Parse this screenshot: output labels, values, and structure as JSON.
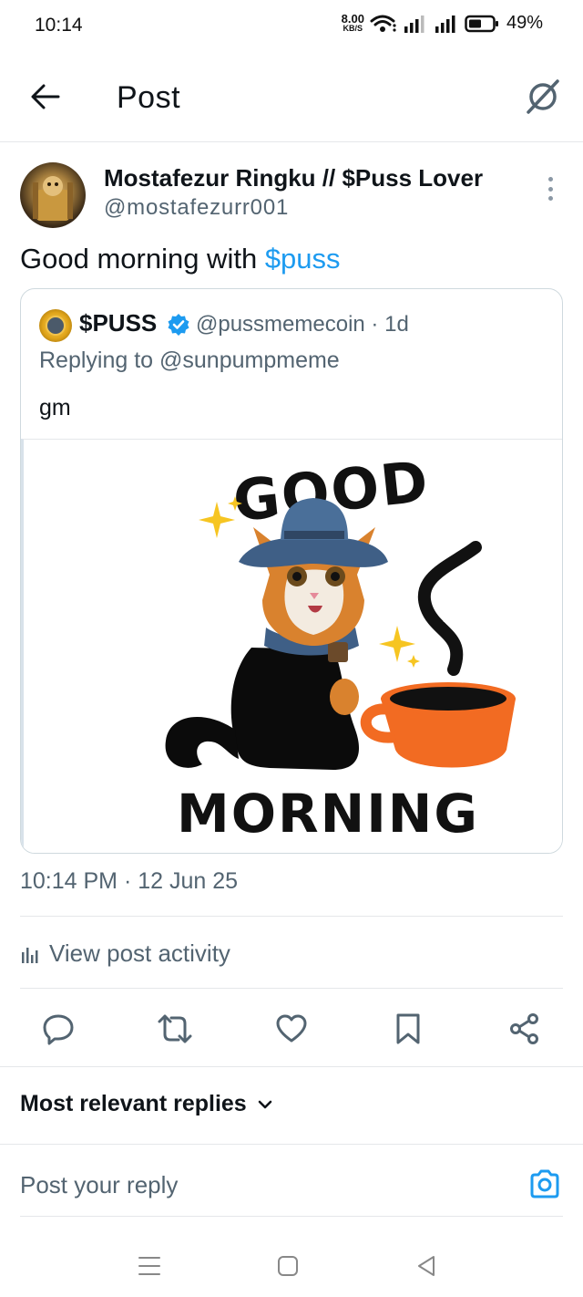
{
  "status_bar": {
    "time": "10:14",
    "net_speed_value": "8.00",
    "net_speed_unit": "KB/S",
    "battery": "49%"
  },
  "header": {
    "title": "Post"
  },
  "post": {
    "author_name": "Mostafezur Ringku // $Puss Lover",
    "author_handle": "@mostafezurr001",
    "text_prefix": "Good morning with ",
    "cashtag": "$puss",
    "timestamp": "10:14 PM · 12 Jun 25"
  },
  "quoted": {
    "name": "$PUSS",
    "handle_time": "@pussmemecoin · 1d",
    "replying_to": "Replying to @sunpumpmeme",
    "text": "gm",
    "image_top_text": "GOOD",
    "image_bottom_text": "MORNING"
  },
  "activity": {
    "label": "View post activity"
  },
  "sort": {
    "label": "Most relevant replies"
  },
  "reply": {
    "placeholder": "Post your reply"
  },
  "colors": {
    "accent": "#1d9bf0",
    "secondary_text": "#536471",
    "divider": "#e5e7ea",
    "hat": "#3f5f86",
    "cup": "#f26b22"
  }
}
